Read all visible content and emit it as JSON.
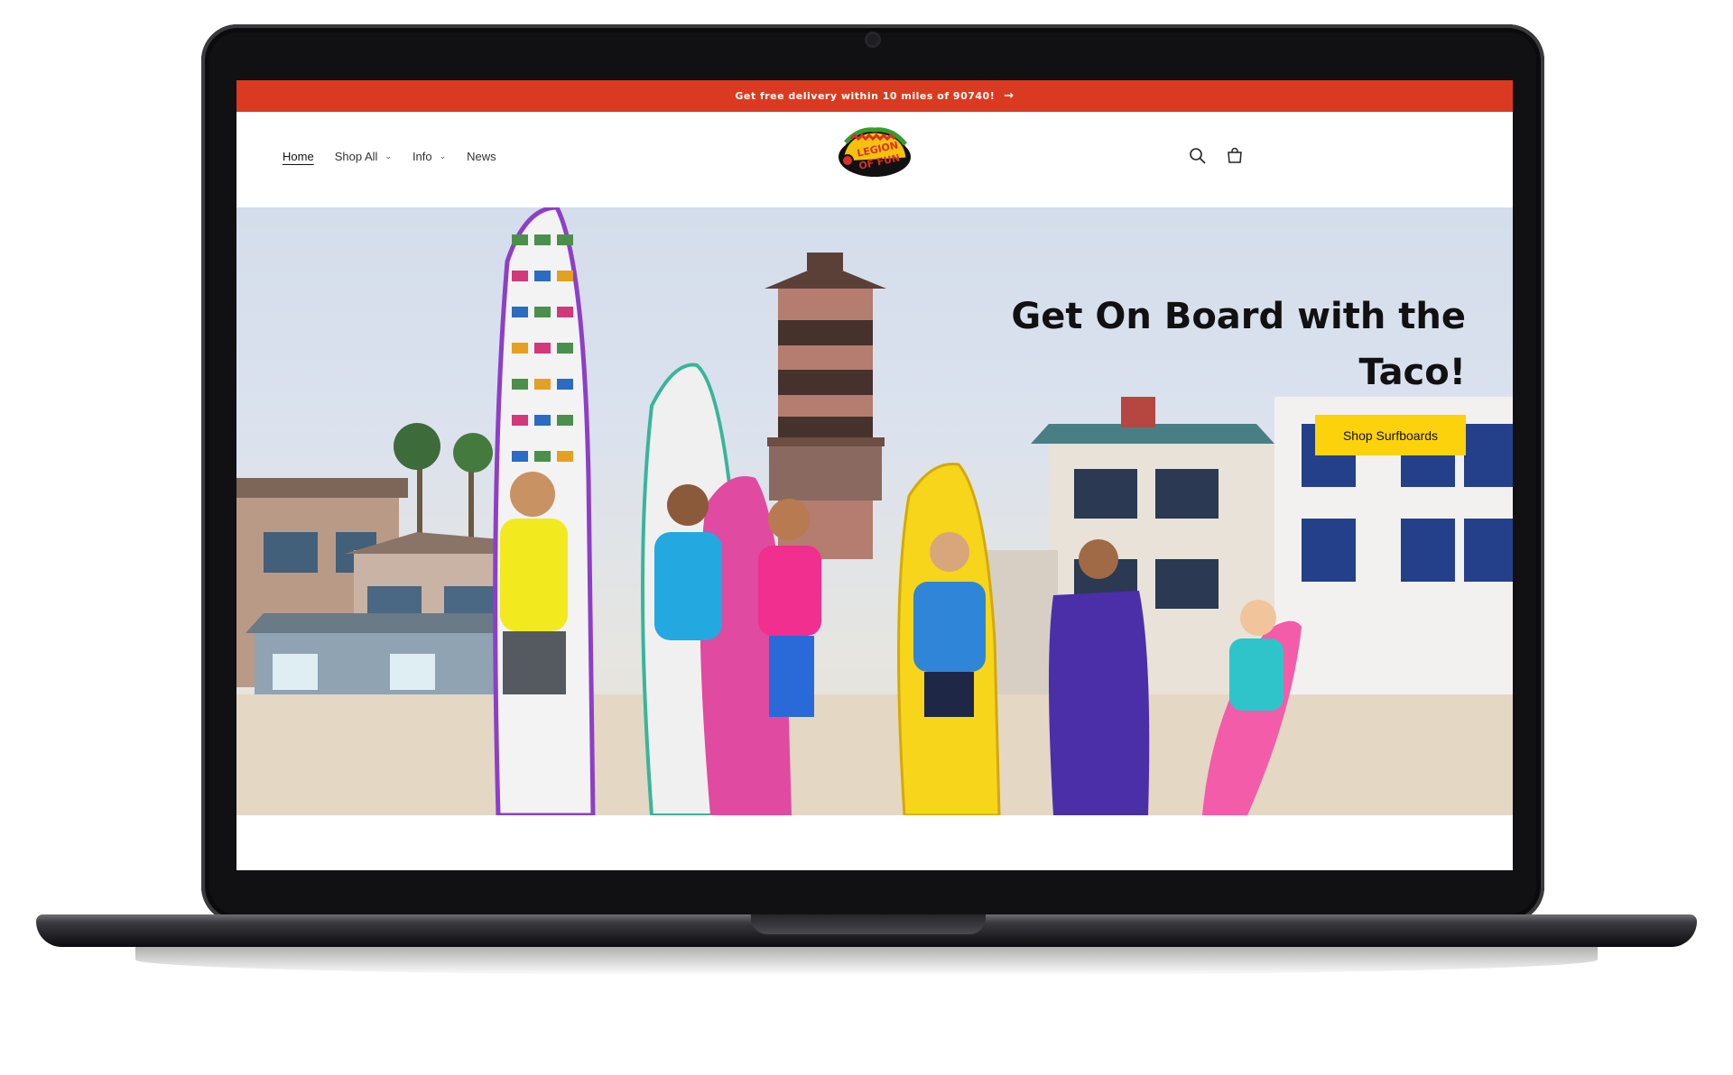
{
  "announcement": {
    "text": "Get free delivery within 10 miles of 90740!",
    "arrow": "→"
  },
  "header": {
    "nav": [
      {
        "label": "Home",
        "active": true
      },
      {
        "label": "Shop All",
        "dropdown": true
      },
      {
        "label": "Info",
        "dropdown": true
      },
      {
        "label": "News"
      }
    ],
    "logo_text": "LEGION OF FUN",
    "icons": [
      "search-icon",
      "cart-icon"
    ]
  },
  "hero": {
    "title_line1": "Get On Board with the",
    "title_line2": "Taco!",
    "cta_label": "Shop Surfboards"
  },
  "colors": {
    "announcement_bg": "#db3a22",
    "cta_bg": "#fbd20c",
    "text": "#111111"
  }
}
